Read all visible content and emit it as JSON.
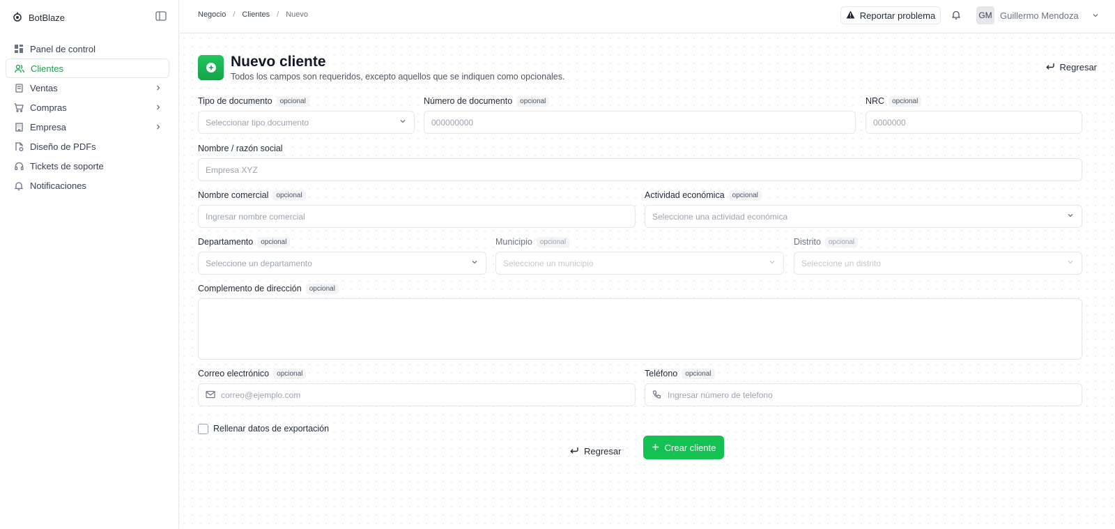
{
  "app": {
    "name": "BotBlaze"
  },
  "sidebar": {
    "items": [
      {
        "label": "Panel de control",
        "icon": "dashboard-icon"
      },
      {
        "label": "Clientes",
        "icon": "users-icon",
        "active": true
      },
      {
        "label": "Ventas",
        "icon": "receipt-icon",
        "expandable": true
      },
      {
        "label": "Compras",
        "icon": "cart-icon",
        "expandable": true
      },
      {
        "label": "Empresa",
        "icon": "building-icon",
        "expandable": true
      },
      {
        "label": "Diseño de PDFs",
        "icon": "pdf-design-icon"
      },
      {
        "label": "Tickets de soporte",
        "icon": "headset-icon"
      },
      {
        "label": "Notificaciones",
        "icon": "bell-icon"
      }
    ]
  },
  "header": {
    "breadcrumb": [
      "Negocio",
      "Clientes",
      "Nuevo"
    ],
    "report_label": "Reportar problema",
    "user": {
      "initials": "GM",
      "name": "Guillermo Mendoza"
    }
  },
  "page": {
    "title": "Nuevo cliente",
    "subtitle": "Todos los campos son requeridos, excepto aquellos que se indiquen como opcionales.",
    "back_label": "Regresar"
  },
  "form": {
    "optional_tag": "opcional",
    "doc_type": {
      "label": "Tipo de documento",
      "placeholder": "Seleccionar tipo documento"
    },
    "doc_number": {
      "label": "Número de documento",
      "placeholder": "000000000"
    },
    "nrc": {
      "label": "NRC",
      "placeholder": "0000000"
    },
    "name": {
      "label": "Nombre / razón social",
      "placeholder": "Empresa XYZ"
    },
    "trade_name": {
      "label": "Nombre comercial",
      "placeholder": "Ingresar nombre comercial"
    },
    "activity": {
      "label": "Actividad económica",
      "placeholder": "Seleccione una actividad económica"
    },
    "department": {
      "label": "Departamento",
      "placeholder": "Seleccione un departamento"
    },
    "municipality": {
      "label": "Municipio",
      "placeholder": "Seleccione un municipio"
    },
    "district": {
      "label": "Distrito",
      "placeholder": "Seleccione un distrito"
    },
    "address": {
      "label": "Complemento de dirección"
    },
    "email": {
      "label": "Correo electrónico",
      "placeholder": "correo@ejemplo.com"
    },
    "phone": {
      "label": "Teléfono",
      "placeholder": "Ingresar número de telefono"
    },
    "export_checkbox": "Rellenar datos de exportación",
    "back_label": "Regresar",
    "submit_label": "Crear cliente"
  },
  "colors": {
    "accent": "#16c153",
    "active_text": "#16a34a"
  }
}
